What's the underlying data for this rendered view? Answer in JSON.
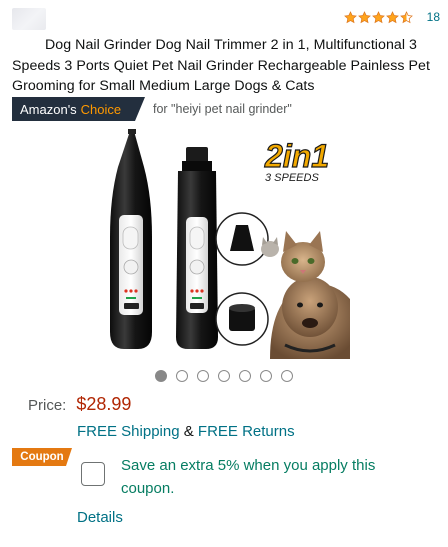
{
  "product": {
    "title": "Dog Nail Grinder Dog Nail Trimmer 2 in 1, Multifunctional 3 Speeds 3 Ports Quiet Pet Nail Grinder Rechargeable Painless Pet Grooming for Small Medium Large Dogs & Cats",
    "rating_stars": 4.5,
    "rating_count": "18",
    "badge_prefix": "Amazon's",
    "badge_choice": "Choice",
    "badge_for": "for \"heiyi pet nail grinder\"",
    "image_text_top": "2in1",
    "image_text_sub": "3 SPEEDS"
  },
  "carousel": {
    "total": 7,
    "active": 0
  },
  "price": {
    "label": "Price:",
    "value": "$28.99"
  },
  "shipping": {
    "free_shipping": "FREE Shipping",
    "amp": "&",
    "free_returns": "FREE Returns"
  },
  "coupon": {
    "tag": "Coupon",
    "text": "Save an extra 5% when you apply this coupon.",
    "checked": false
  },
  "details_link": "Details",
  "colors": {
    "link": "#007185",
    "price": "#B12704",
    "coupon_text": "#067D62",
    "coupon_tag": "#E47911",
    "badge_bg": "#232F3E",
    "badge_accent": "#FF9900",
    "star": "#FFA41C"
  }
}
